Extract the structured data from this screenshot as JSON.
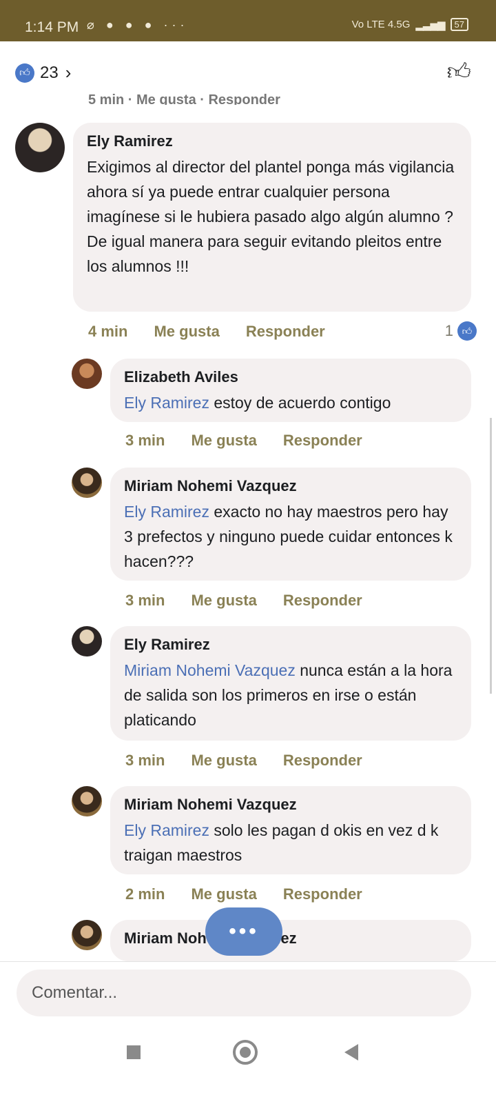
{
  "status_bar": {
    "time": "1:14 PM",
    "icons": "⌀ ● ● ● ···",
    "network": "Vo LTE 4.5G",
    "battery": "57"
  },
  "header": {
    "like_icon": "like-icon",
    "like_count": "23",
    "chevron": "›"
  },
  "comments": [
    {
      "author": "Ely Ramirez",
      "text": "Exigimos al director del plantel ponga más vigilancia ahora sí ya puede entrar cualquier persona imagínese si le hubiera pasado algo algún alumno ? De igual manera para seguir evitando pleitos entre los alumnos !!!",
      "time": "4 min",
      "like_label": "Me gusta",
      "reply_label": "Responder",
      "reactions": "1"
    },
    {
      "author": "Elizabeth Aviles",
      "mention": "Ely Ramirez",
      "text": "estoy de acuerdo contigo",
      "time": "3 min",
      "like_label": "Me gusta",
      "reply_label": "Responder"
    },
    {
      "author": "Miriam Nohemi Vazquez",
      "mention": "Ely Ramirez",
      "text": "exacto no hay maestros pero hay 3 prefectos y ninguno puede cuidar entonces k hacen???",
      "time": "3 min",
      "like_label": "Me gusta",
      "reply_label": "Responder"
    },
    {
      "author": "Ely Ramirez",
      "mention": "Miriam Nohemi Vazquez",
      "text": "nunca están a la hora de salida son los primeros en irse o están platicando",
      "time": "3 min",
      "like_label": "Me gusta",
      "reply_label": "Responder"
    },
    {
      "author": "Miriam Nohemi Vazquez",
      "mention": "Ely Ramirez",
      "text": "solo les pagan d okis en vez d k traigan maestros",
      "time": "2 min",
      "like_label": "Me gusta",
      "reply_label": "Responder"
    },
    {
      "author": "Miriam Nohemi Vazquez"
    }
  ],
  "more_button": "•••",
  "composer": {
    "placeholder": "Comentar..."
  },
  "colors": {
    "status_bar": "#6e5d2c",
    "bubble": "#f4f0f0",
    "mention": "#4b6fb5",
    "accent": "#5f87c7"
  }
}
